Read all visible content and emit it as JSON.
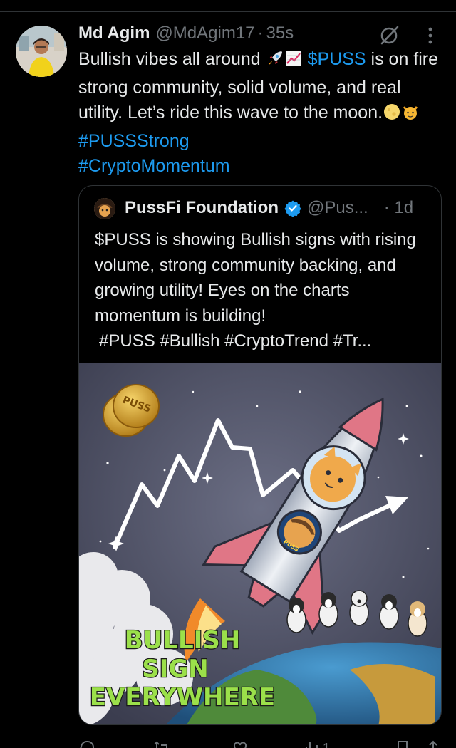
{
  "tweet": {
    "author_name": "Md Agim",
    "author_handle": "@MdAgim17",
    "separator": "·",
    "time": "35s",
    "text_before": "Bullish vibes all around",
    "cashtag": "$PUSS",
    "text_mid": "is on fire  strong community, solid volume, and real utility. Let’s ride this wave to the moon.",
    "hashtag_1": "#PUSSStrong",
    "hashtag_2": "#CryptoMomentum"
  },
  "quote": {
    "author_name": "PussFi Foundation",
    "author_handle": "@Pus...",
    "separator": "·",
    "time": "1d",
    "text": "$PUSS is showing Bullish signs with rising volume, strong community backing, and growing utility! Eyes on the charts momentum is building!",
    "tags": "#PUSS #Bullish #CryptoTrend #Tr...",
    "image_caption": [
      "BULLISH",
      "SIGN",
      "EVERYWHERE"
    ],
    "coin_label": "PUSS",
    "badge_label": "PUSS"
  },
  "actions": {
    "views_count": "1"
  },
  "colors": {
    "background": "#000000",
    "text": "#e7e9ea",
    "secondary": "#71767b",
    "link": "#1d9bf0",
    "border": "#2f3336",
    "caption_fill": "#9be04a"
  },
  "icons": [
    "grok-icon",
    "more-icon",
    "verified-icon",
    "reply-icon",
    "retweet-icon",
    "like-icon",
    "views-icon",
    "bookmark-icon",
    "share-icon"
  ]
}
